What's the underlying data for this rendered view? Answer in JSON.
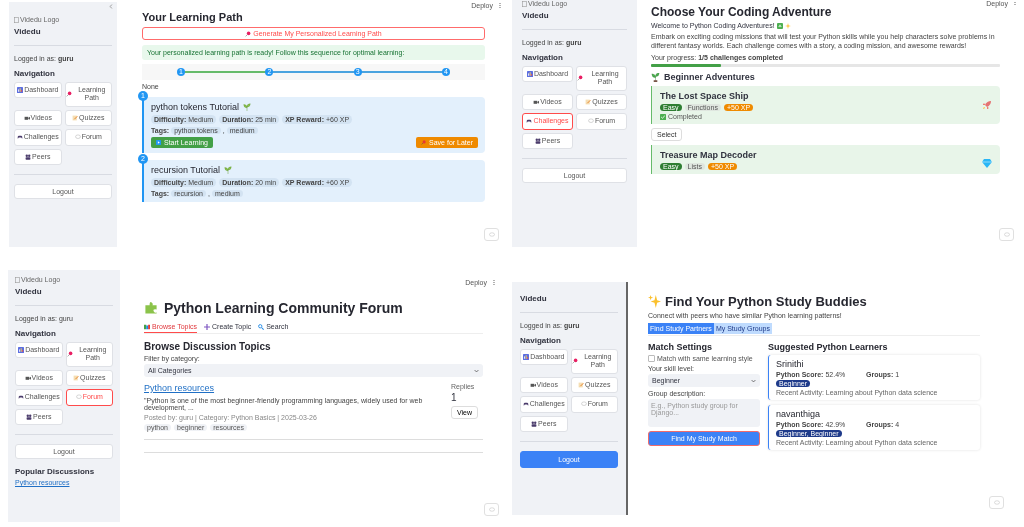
{
  "learning_path_screen": {
    "sidebar": {
      "logo_alt": "Videdu Logo",
      "brand": "Videdu",
      "login": "Logged in as: **guru**",
      "nav_title": "Navigation",
      "nav": [
        {
          "label": "Dashboard",
          "selected": false
        },
        {
          "label": "Learning Path",
          "selected": false
        },
        {
          "label": "Videos",
          "selected": false
        },
        {
          "label": "Quizzes",
          "selected": false
        },
        {
          "label": "Challenges",
          "selected": false
        },
        {
          "label": "Forum",
          "selected": false
        },
        {
          "label": "Peers",
          "selected": false
        }
      ],
      "logout": {
        "label": "Logout",
        "kind": "secondary"
      }
    },
    "deploy": "Deploy",
    "title": "Your Learning Path",
    "generate_button": "Generate My Personalized Learning Path",
    "success": "Your personalized learning path is ready! Follow this sequence for optimal learning:",
    "steps": [
      "1",
      "2",
      "3",
      "4"
    ],
    "path_progress": {
      "level": 0.333
    },
    "note": "None",
    "cards": [
      {
        "number": "1",
        "title": "python tokens Tutorial",
        "difficulty_label": "Difficulty:",
        "difficulty": "Medium",
        "duration_label": "Duration:",
        "duration": "25 min",
        "xp_label": "XP Reward:",
        "xp": "+60 XP",
        "tags_label": "Tags:",
        "tags": [
          "python tokens",
          "medium"
        ],
        "start_button": "Start Learning",
        "save_button": "Save for Later"
      },
      {
        "number": "2",
        "title": "recursion Tutorial",
        "difficulty_label": "Difficulty:",
        "difficulty": "Medium",
        "duration_label": "Duration:",
        "duration": "20 min",
        "xp_label": "XP Reward:",
        "xp": "+60 XP",
        "tags_label": "Tags:",
        "tags": [
          "recursion",
          "medium"
        ]
      }
    ],
    "tag_separator": ","
  },
  "challenges_screen": {
    "sidebar": {
      "logo_alt": "Videdu Logo",
      "brand": "Videdu",
      "login": "Logged in as: **guru**",
      "nav_title": "Navigation",
      "nav": [
        {
          "label": "Dashboard",
          "selected": false
        },
        {
          "label": "Learning Path",
          "selected": false
        },
        {
          "label": "Videos",
          "selected": false
        },
        {
          "label": "Quizzes",
          "selected": false
        },
        {
          "label": "Challenges",
          "selected": true
        },
        {
          "label": "Forum",
          "selected": false
        },
        {
          "label": "Peers",
          "selected": false
        }
      ],
      "logout": {
        "label": "Logout",
        "kind": "secondary"
      }
    },
    "deploy": "Deploy",
    "title": "Choose Your Coding Adventure",
    "welcome": "Welcome to Python Coding Adventures!",
    "intro": "Embark on exciting coding missions that will test your Python skills while you help characters solve problems in different fantasy worlds. Each challenge comes with a story, a coding mission, and awesome rewards!",
    "progress_text": "Your progress: **1/5 challenges completed**",
    "progress": {
      "level": 0.2
    },
    "section": "Beginner Adventures",
    "challenges": [
      {
        "title": "The Lost Space Ship",
        "difficulty": "Easy",
        "topic": "Functions",
        "xp": "+50 XP",
        "completed": true,
        "completed_label": "Completed",
        "select_button": "Select"
      },
      {
        "title": "Treasure Map Decoder",
        "difficulty": "Easy",
        "topic": "Lists",
        "xp": "+50 XP",
        "completed": false
      }
    ]
  },
  "forum_screen": {
    "sidebar": {
      "logo_alt": "Videdu Logo",
      "brand": "Videdu",
      "login": "Logged in as: guru",
      "nav_title": "Navigation",
      "nav": [
        {
          "label": "Dashboard",
          "selected": false
        },
        {
          "label": "Learning Path",
          "selected": false
        },
        {
          "label": "Videos",
          "selected": false
        },
        {
          "label": "Quizzes",
          "selected": false
        },
        {
          "label": "Challenges",
          "selected": false
        },
        {
          "label": "Forum",
          "selected": true
        },
        {
          "label": "Peers",
          "selected": false
        }
      ],
      "logout": {
        "label": "Logout",
        "kind": "secondary"
      },
      "popular_title": "Popular Discussions",
      "popular_links": [
        "Python resources"
      ]
    },
    "deploy": "Deploy",
    "title": "Python Learning Community Forum",
    "tabs": [
      {
        "label": "Browse Topics",
        "selected": true
      },
      {
        "label": "Create Topic",
        "selected": false
      },
      {
        "label": "Search",
        "selected": false
      }
    ],
    "heading": "Browse Discussion Topics",
    "filter_label": "Filter by category:",
    "filter_value": "All Categories",
    "topics": [
      {
        "title": "Python resources",
        "excerpt": "\"Python is one of the most beginner-friendly programming languages, widely used for web development, ...",
        "meta": "Posted by: guru | Category: Python Basics | 2025-03-26",
        "tags": [
          "python",
          "beginner",
          "resources"
        ],
        "replies_label": "Replies",
        "replies": "1",
        "view_button": "View"
      }
    ]
  },
  "peers_screen": {
    "sidebar": {
      "brand": "Videdu",
      "login": "Logged in as: **guru**",
      "nav_title": "Navigation",
      "nav": [
        {
          "label": "Dashboard",
          "selected": false
        },
        {
          "label": "Learning Path",
          "selected": false
        },
        {
          "label": "Videos",
          "selected": false
        },
        {
          "label": "Quizzes",
          "selected": false
        },
        {
          "label": "Challenges",
          "selected": false
        },
        {
          "label": "Forum",
          "selected": false
        },
        {
          "label": "Peers",
          "selected": false
        }
      ],
      "logout": {
        "label": "Logout",
        "kind": "primary"
      }
    },
    "title": "Find Your Python Study Buddies",
    "subtitle": "Connect with peers who have similar Python learning patterns!",
    "tabs": [
      {
        "label": "Find Study Partners",
        "selected": true
      },
      {
        "label": "My Study Groups",
        "selected": false
      }
    ],
    "settings_title": "Match Settings",
    "same_style": {
      "label": "Match with same learning style",
      "checked": false
    },
    "skill_label": "Your skill level:",
    "skill_value": "Beginner",
    "group_label": "Group description:",
    "group_placeholder": "E.g., Python study group for Django...",
    "find_button": "Find My Study Match",
    "learners_title": "Suggested Python Learners",
    "learners": [
      {
        "name": "Srinithi",
        "score_label": "Python Score:",
        "score": "52.4%",
        "groups_label": "Groups:",
        "groups": "1",
        "badge": "Beginner",
        "activity": "Recent Activity: Learning about Python data science"
      },
      {
        "name": "navanthiga",
        "score_label": "Python Score:",
        "score": "42.9%",
        "groups_label": "Groups:",
        "groups": "4",
        "badge": "Beginner, Beginner",
        "activity": "Recent Activity: Learning about Python data science"
      }
    ]
  }
}
